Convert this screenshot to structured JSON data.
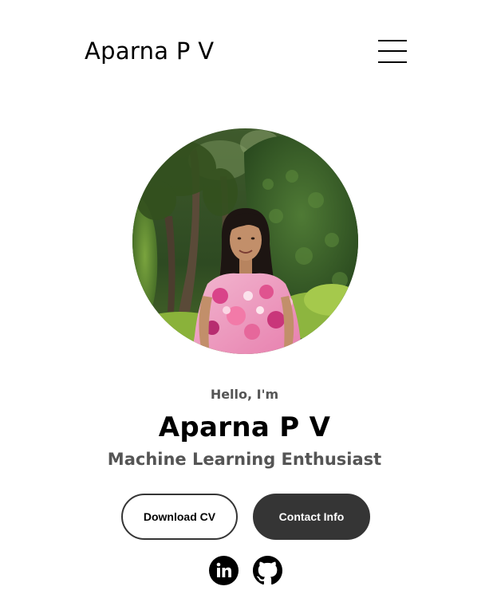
{
  "nav": {
    "logo": "Aparna P V",
    "menu_icon": "hamburger-menu-icon"
  },
  "profile": {
    "image_alt": "Profile picture of Aparna P V"
  },
  "hero": {
    "greeting": "Hello, I'm",
    "name": "Aparna P V",
    "role": "Machine Learning Enthusiast"
  },
  "buttons": {
    "download_cv": "Download CV",
    "contact_info": "Contact Info"
  },
  "socials": {
    "linkedin_icon": "linkedin-icon",
    "github_icon": "github-icon"
  },
  "colors": {
    "button_dark": "#353535",
    "text_secondary": "#555555",
    "text_primary": "#000000"
  }
}
